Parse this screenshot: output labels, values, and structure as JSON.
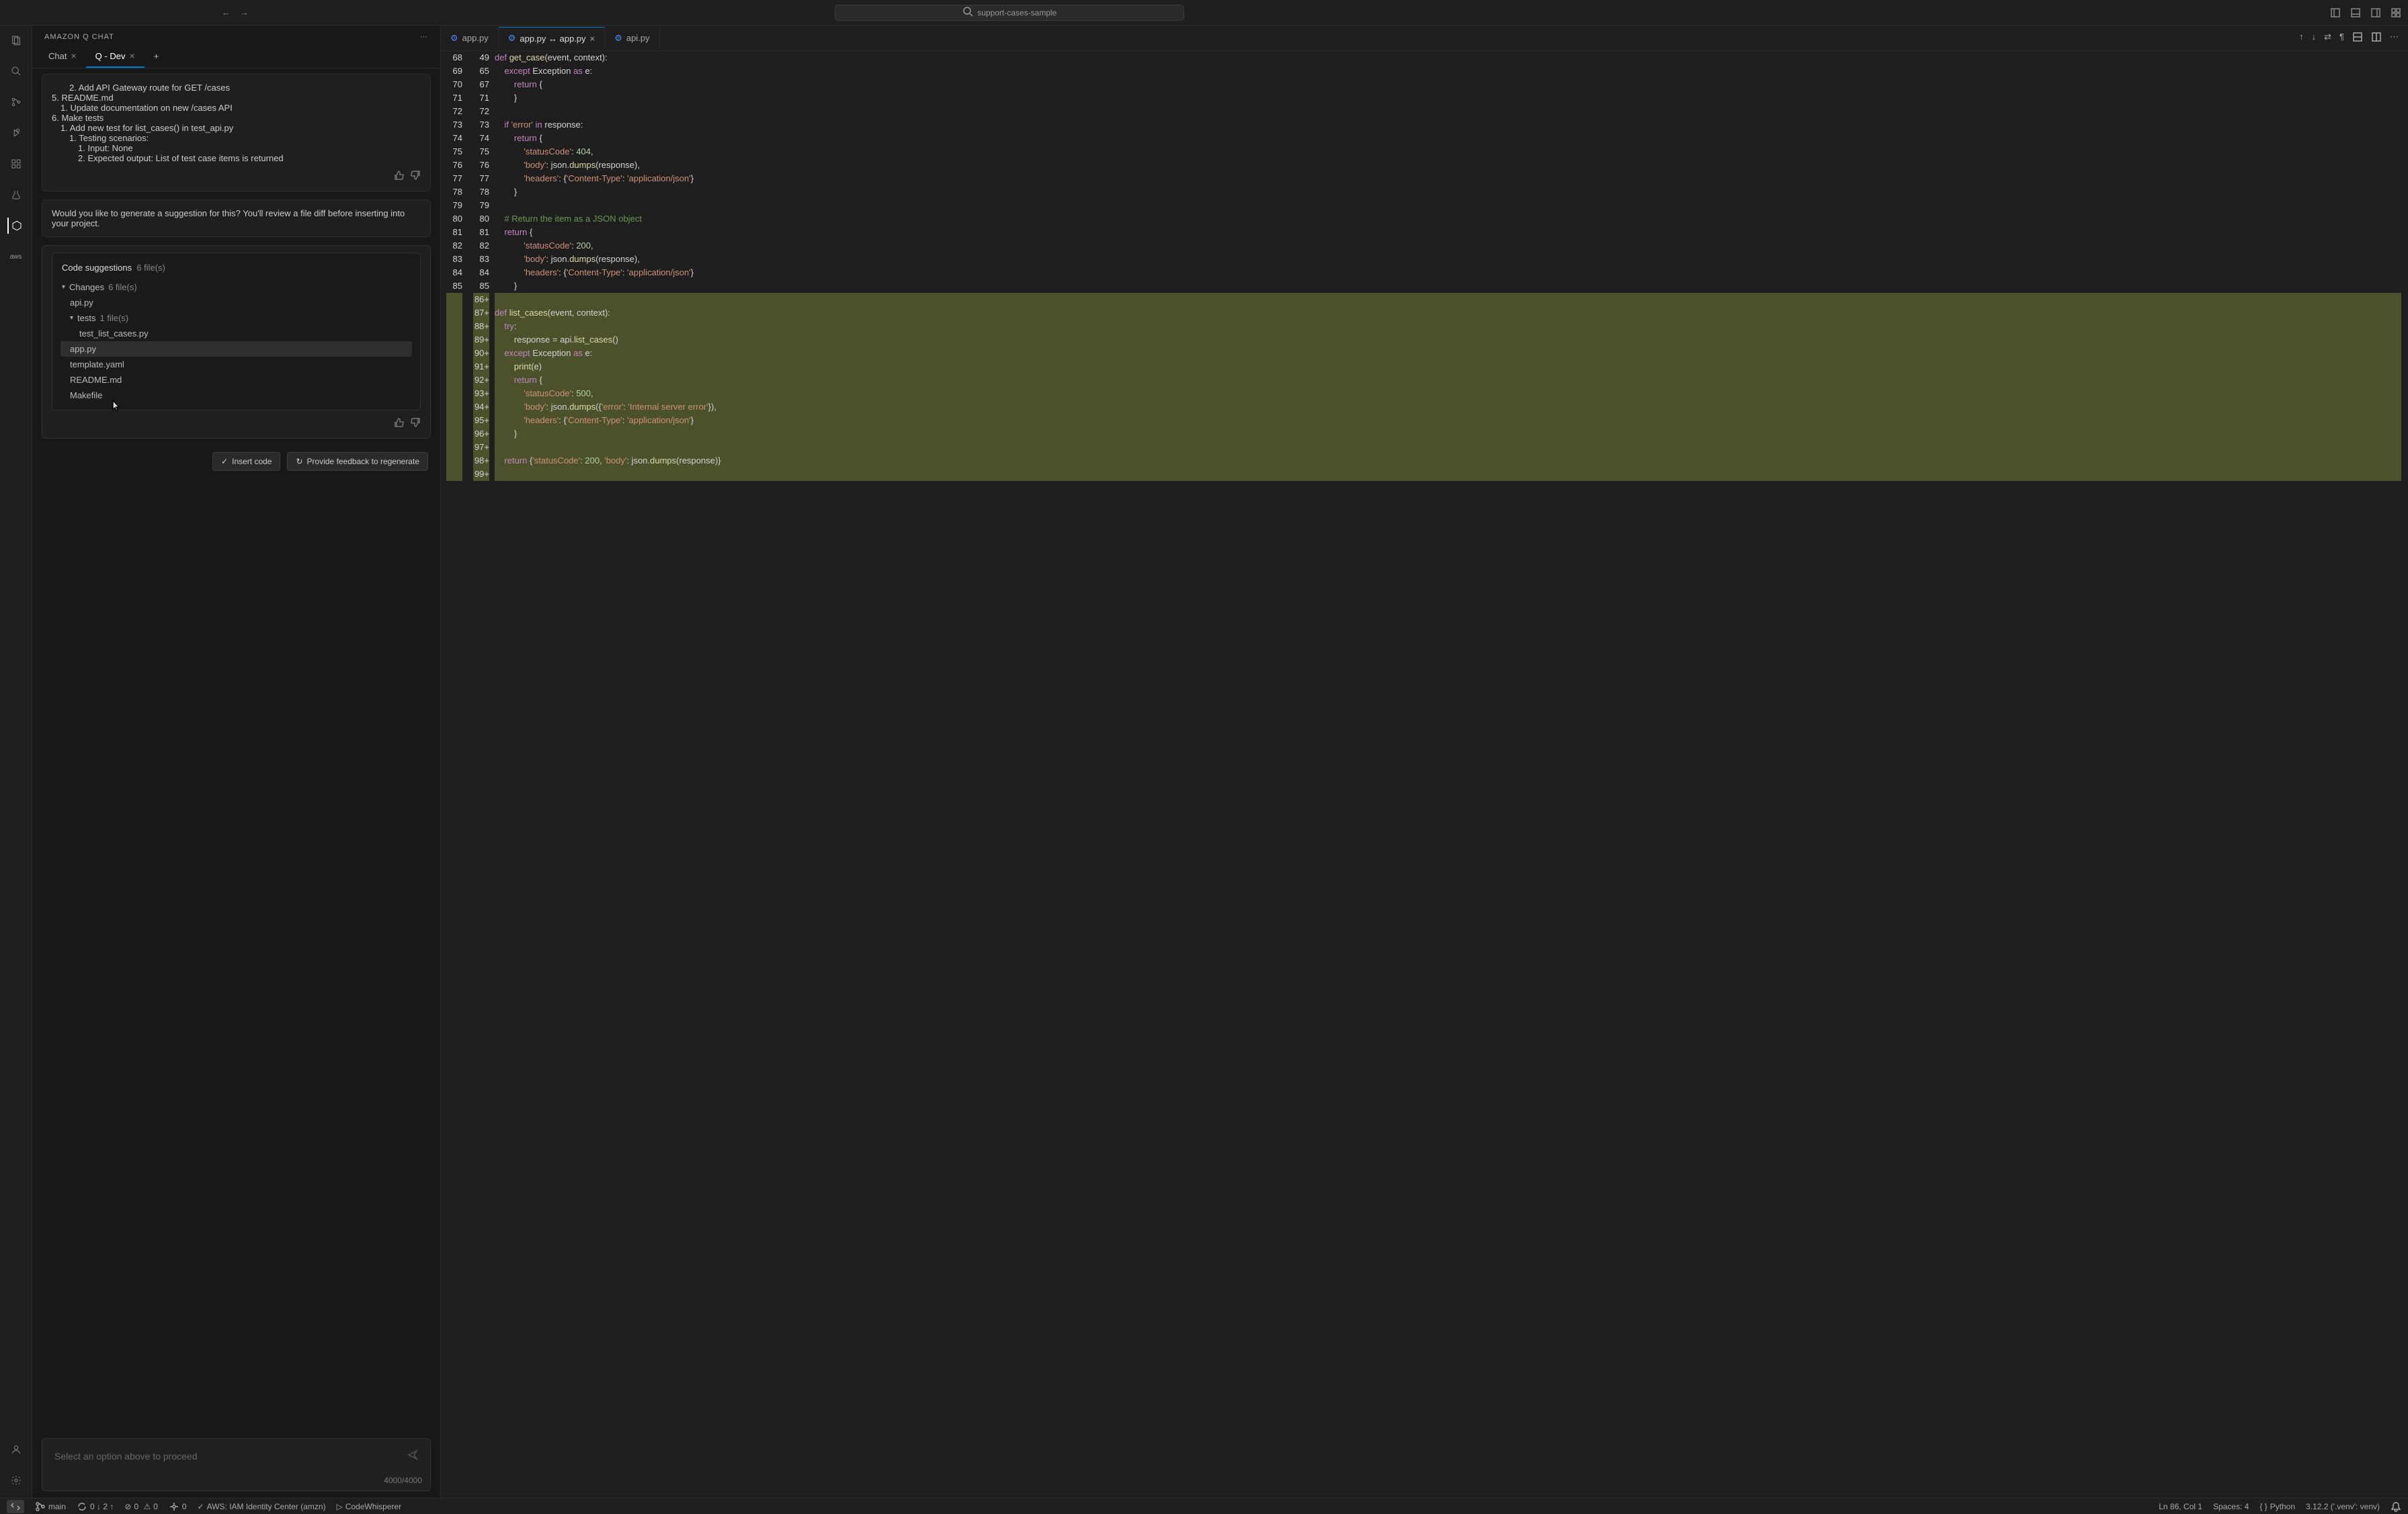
{
  "titlebar": {
    "search": "support-cases-sample"
  },
  "sidebar_title": "AMAZON Q  CHAT",
  "chat_tabs": [
    {
      "label": "Chat"
    },
    {
      "label": "Q - Dev",
      "active": true
    }
  ],
  "chat_outline": {
    "i1": "2. Add API Gateway route for GET /cases",
    "i2": "5. README.md",
    "i3": "1. Update documentation on new /cases API",
    "i4": "6. Make tests",
    "i5": "1. Add new test for list_cases() in test_api.py",
    "i6": "1. Testing scenarios:",
    "i7": "1. Input: None",
    "i8": "2. Expected output: List of test case items is returned"
  },
  "prompt_q": "Would you like to generate a suggestion for this? You'll review a file diff before inserting into your project.",
  "suggest": {
    "title": "Code suggestions",
    "count": "6 file(s)",
    "changes_label": "Changes",
    "changes_count": "6 file(s)",
    "tests_label": "tests",
    "tests_count": "1 file(s)",
    "files": {
      "api": "api.py",
      "test": "test_list_cases.py",
      "app": "app.py",
      "template": "template.yaml",
      "readme": "README.md",
      "make": "Makefile"
    }
  },
  "actions": {
    "insert": "Insert code",
    "feedback": "Provide feedback to regenerate"
  },
  "input_placeholder": "Select an option above to proceed",
  "counter": "4000/4000",
  "editor_tabs": [
    {
      "label": "app.py"
    },
    {
      "label": "app.py ↔ app.py",
      "active": true
    },
    {
      "label": "api.py"
    }
  ],
  "code": {
    "left_gutter": [
      "68",
      "69",
      "70",
      "71",
      "72",
      "73",
      "74",
      "75",
      "76",
      "77",
      "78",
      "79",
      "80",
      "81",
      "82",
      "83",
      "84",
      "85",
      "",
      "",
      "",
      "",
      "",
      "",
      "",
      "",
      "",
      "",
      "",
      "",
      "",
      "",
      ""
    ],
    "right_gutter": [
      "49",
      "65",
      "67",
      "71",
      "72",
      "73",
      "74",
      "75",
      "76",
      "77",
      "78",
      "79",
      "80",
      "81",
      "82",
      "83",
      "84",
      "85",
      "86+",
      "87+",
      "88+",
      "89+",
      "90+",
      "91+",
      "92+",
      "93+",
      "94+",
      "95+",
      "96+",
      "97+",
      "98+",
      "99+"
    ],
    "lines": [
      {
        "a": false,
        "html": "<span class='kwd'>def</span> <span class='fn'>get_case</span>(event, context):"
      },
      {
        "a": false,
        "html": "    <span class='kwd'>except</span> Exception <span class='kwd'>as</span> e:"
      },
      {
        "a": false,
        "html": "        <span class='kwd'>return</span> {"
      },
      {
        "a": false,
        "html": "        }"
      },
      {
        "a": false,
        "html": ""
      },
      {
        "a": false,
        "html": "    <span class='kwd'>if</span> <span class='str'>'error'</span> <span class='kwd'>in</span> response:"
      },
      {
        "a": false,
        "html": "        <span class='kwd'>return</span> {"
      },
      {
        "a": false,
        "html": "            <span class='str'>'statusCode'</span>: <span class='num'>404</span>,"
      },
      {
        "a": false,
        "html": "            <span class='str'>'body'</span>: json.<span class='fn'>dumps</span>(response),"
      },
      {
        "a": false,
        "html": "            <span class='str'>'headers'</span>: {<span class='str'>'Content-Type'</span>: <span class='str'>'application/json'</span>}"
      },
      {
        "a": false,
        "html": "        }"
      },
      {
        "a": false,
        "html": ""
      },
      {
        "a": false,
        "html": "    <span class='comment'># Return the item as a JSON object</span>"
      },
      {
        "a": false,
        "html": "    <span class='kwd'>return</span> {"
      },
      {
        "a": false,
        "html": "            <span class='str'>'statusCode'</span>: <span class='num'>200</span>,"
      },
      {
        "a": false,
        "html": "            <span class='str'>'body'</span>: json.<span class='fn'>dumps</span>(response),"
      },
      {
        "a": false,
        "html": "            <span class='str'>'headers'</span>: {<span class='str'>'Content-Type'</span>: <span class='str'>'application/json'</span>}"
      },
      {
        "a": false,
        "html": "        }"
      },
      {
        "a": true,
        "html": ""
      },
      {
        "a": true,
        "html": "<span class='kwd'>def</span> <span class='fn'>list_cases</span>(event, context):"
      },
      {
        "a": true,
        "html": "    <span class='kwd'>try</span>:"
      },
      {
        "a": true,
        "html": "        response = api.<span class='fn'>list_cases</span>()"
      },
      {
        "a": true,
        "html": "    <span class='kwd'>except</span> Exception <span class='kwd'>as</span> e:"
      },
      {
        "a": true,
        "html": "        <span class='fn'>print</span>(e)"
      },
      {
        "a": true,
        "html": "        <span class='kwd'>return</span> {"
      },
      {
        "a": true,
        "html": "            <span class='str'>'statusCode'</span>: <span class='num'>500</span>,"
      },
      {
        "a": true,
        "html": "            <span class='str'>'body'</span>: json.<span class='fn'>dumps</span>({<span class='str'>'error'</span>: <span class='str'>'Internal server error'</span>}),"
      },
      {
        "a": true,
        "html": "            <span class='str'>'headers'</span>: {<span class='str'>'Content-Type'</span>: <span class='str'>'application/json'</span>}"
      },
      {
        "a": true,
        "html": "        }"
      },
      {
        "a": true,
        "html": ""
      },
      {
        "a": true,
        "html": "    <span class='kwd'>return</span> {<span class='str'>'statusCode'</span>: <span class='num'>200</span>, <span class='str'>'body'</span>: json.<span class='fn'>dumps</span>(response)}"
      },
      {
        "a": true,
        "html": ""
      }
    ]
  },
  "status": {
    "branch": "main",
    "sync": "0 ↓ 2 ↑",
    "errors": "0",
    "warnings": "0",
    "ports": "0",
    "aws": "AWS: IAM Identity Center (amzn)",
    "cw": "CodeWhisperer",
    "pos": "Ln 86, Col 1",
    "spaces": "Spaces: 4",
    "lang": "Python",
    "py": "3.12.2 ('.venv': venv)"
  }
}
